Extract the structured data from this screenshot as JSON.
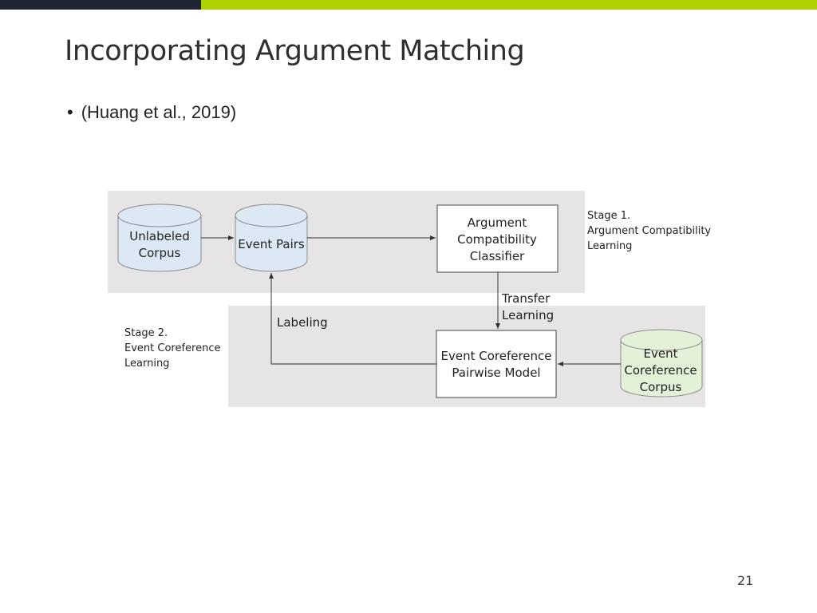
{
  "slide": {
    "title": "Incorporating Argument Matching",
    "bullet_marker": "•",
    "bullet_text": "(Huang et al., 2019)",
    "page_number": "21"
  },
  "colors": {
    "top_bar_dark": "#1f2430",
    "top_bar_accent": "#aed100",
    "stage_background": "#e6e4e4",
    "blue_cylinder": "#dce9f5",
    "green_cylinder": "#e3f1d8"
  },
  "diagram": {
    "stage1_label": [
      "Stage 1.",
      "Argument Compatibility",
      "Learning"
    ],
    "stage2_label": [
      "Stage 2.",
      "Event Coreference",
      "Learning"
    ],
    "nodes": {
      "unlabeled_corpus": [
        "Unlabeled",
        "Corpus"
      ],
      "event_pairs": [
        "Event Pairs"
      ],
      "classifier": [
        "Argument",
        "Compatibility",
        "Classifier"
      ],
      "pairwise_model": [
        "Event Coreference",
        "Pairwise Model"
      ],
      "coref_corpus": [
        "Event",
        "Coreference",
        "Corpus"
      ]
    },
    "edge_labels": {
      "transfer": [
        "Transfer",
        "Learning"
      ],
      "labeling": "Labeling"
    }
  }
}
